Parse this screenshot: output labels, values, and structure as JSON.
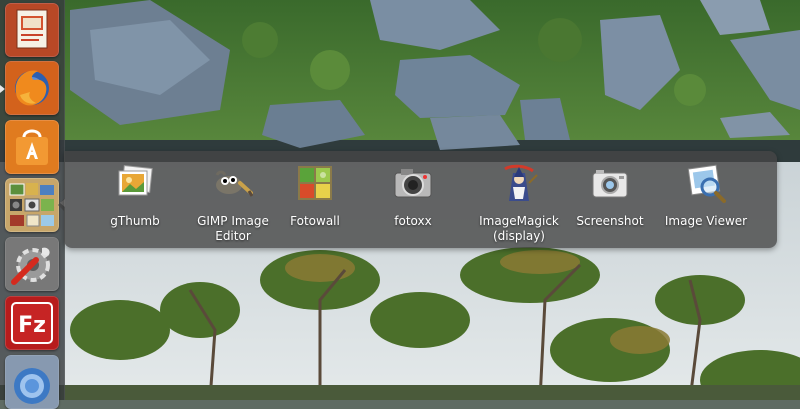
{
  "launcher": {
    "items": [
      {
        "icon": "impress-presentation-icon"
      },
      {
        "icon": "firefox-icon"
      },
      {
        "icon": "software-center-icon"
      },
      {
        "icon": "image-apps-group-icon"
      },
      {
        "icon": "system-settings-icon"
      },
      {
        "icon": "filezilla-icon",
        "glyph": "Fz"
      },
      {
        "icon": "chromium-icon"
      }
    ]
  },
  "lens": {
    "apps": [
      {
        "label": "gThumb",
        "icon": "gthumb-icon"
      },
      {
        "label": "GIMP Image Editor",
        "icon": "gimp-icon"
      },
      {
        "label": "Fotowall",
        "icon": "fotowall-icon"
      },
      {
        "label": "fotoxx",
        "icon": "fotoxx-camera-icon"
      },
      {
        "label": "ImageMagick (display)",
        "icon": "imagemagick-wizard-icon"
      },
      {
        "label": "Screenshot",
        "icon": "screenshot-camera-icon"
      },
      {
        "label": "Image Viewer",
        "icon": "image-viewer-icon"
      }
    ]
  },
  "colors": {
    "launcher_bg": "#373c3e",
    "panel_bg": "#464646",
    "firefox_orange": "#e8661c",
    "software_center_orange": "#f28a1e",
    "filezilla_red": "#bf1b1b"
  }
}
